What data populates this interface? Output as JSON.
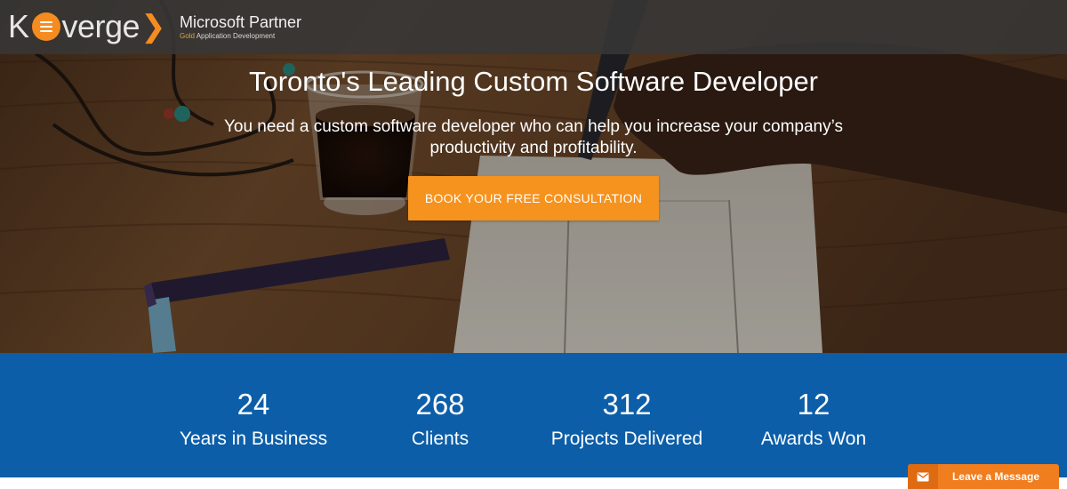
{
  "brand": {
    "logo_k": "K",
    "logo_rest": "verge",
    "partner_title": "Microsoft Partner",
    "partner_gold": "Gold",
    "partner_sub": "Application Development"
  },
  "hero": {
    "title": "Toronto's Leading Custom Software Developer",
    "description": "You need a custom software developer who can help you increase your company’s productivity and profitability.",
    "cta_label": "BOOK YOUR FREE CONSULTATION"
  },
  "stats": [
    {
      "number": "24",
      "label": "Years in Business"
    },
    {
      "number": "268",
      "label": "Clients"
    },
    {
      "number": "312",
      "label": "Projects Delivered"
    },
    {
      "number": "12",
      "label": "Awards Won"
    }
  ],
  "chat": {
    "label": "Leave a Message",
    "icon": "envelope-icon"
  },
  "colors": {
    "accent_orange": "#f6921e",
    "stats_blue": "#0c5ea8",
    "topbar": "#373737"
  }
}
